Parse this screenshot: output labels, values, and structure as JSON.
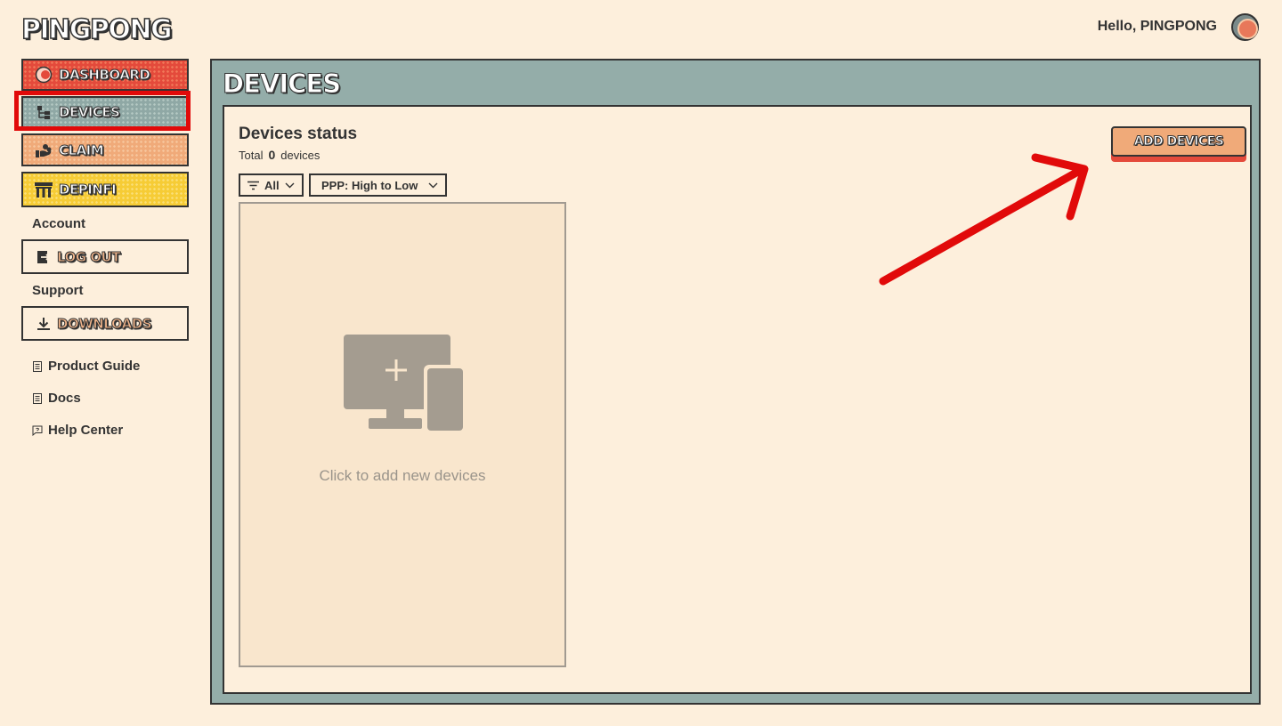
{
  "app": {
    "logo_text": "PINGPONG",
    "greeting": "Hello, PINGPONG"
  },
  "sidebar": {
    "nav": [
      {
        "label": "DASHBOARD",
        "icon": "dashboard-icon",
        "color": "#e44a3b"
      },
      {
        "label": "DEVICES",
        "icon": "devices-icon",
        "color": "#8fa8a5",
        "active": true
      },
      {
        "label": "CLAIM",
        "icon": "claim-icon",
        "color": "#f0aa79"
      },
      {
        "label": "DEPINFI",
        "icon": "store-icon",
        "color": "#f6cc35"
      }
    ],
    "account_label": "Account",
    "logout_label": "LOG OUT",
    "support_label": "Support",
    "downloads_label": "DOWNLOADS",
    "links": [
      {
        "label": "Product Guide",
        "icon": "document-icon"
      },
      {
        "label": "Docs",
        "icon": "document-icon"
      },
      {
        "label": "Help Center",
        "icon": "chat-icon"
      }
    ]
  },
  "main": {
    "title": "DEVICES",
    "status_title": "Devices status",
    "total_prefix": "Total",
    "total_count": "0",
    "total_suffix": "devices",
    "filter_selected": "All",
    "sort_selected": "PPP: High to Low",
    "add_tile_label": "Click to add new devices",
    "add_button_label": "ADD DEVICES"
  },
  "colors": {
    "background": "#fdefdc",
    "panel": "#94ada9",
    "accent_red": "#e44a3b",
    "accent_orange": "#f0aa79",
    "accent_yellow": "#f6cc35",
    "annotation_red": "#e10a0a"
  }
}
